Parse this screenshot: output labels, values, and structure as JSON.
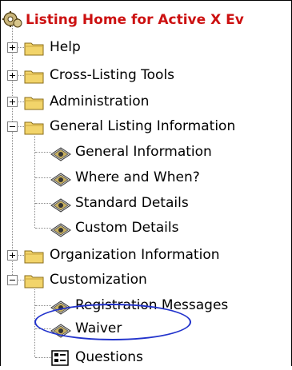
{
  "tree": {
    "title": "Listing Home for Active X Ev",
    "items": [
      {
        "label": "Help",
        "state": "collapsed"
      },
      {
        "label": "Cross-Listing Tools",
        "state": "collapsed"
      },
      {
        "label": "Administration",
        "state": "collapsed"
      },
      {
        "label": "General Listing Information",
        "state": "expanded",
        "children": [
          "General Information",
          "Where and When?",
          "Standard Details",
          "Custom Details"
        ]
      },
      {
        "label": "Organization Information",
        "state": "collapsed"
      },
      {
        "label": "Customization",
        "state": "expanded",
        "children": [
          "Registration Messages",
          "Waiver",
          "Questions"
        ]
      }
    ]
  },
  "highlight": {
    "item": "Waiver",
    "color": "#2233cc"
  },
  "colors": {
    "title": "#cc1111",
    "folder": "#f2d46a"
  }
}
